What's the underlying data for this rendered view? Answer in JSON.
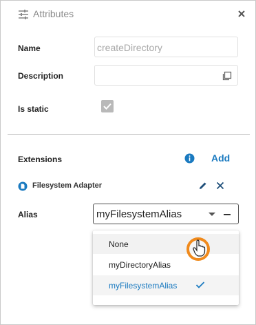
{
  "panel": {
    "title": "Attributes",
    "close_icon": "close-icon",
    "title_icon": "tune-icon"
  },
  "fields": {
    "name_label": "Name",
    "name_value": "createDirectory",
    "description_label": "Description",
    "description_value": "",
    "is_static_label": "Is static",
    "is_static_checked": true
  },
  "extensions": {
    "label": "Extensions",
    "add_label": "Add",
    "adapter_title": "Filesystem Adapter",
    "alias_label": "Alias",
    "alias_selected": "myFilesystemAlias",
    "options": [
      {
        "label": "None",
        "state": "hover"
      },
      {
        "label": "myDirectoryAlias",
        "state": "normal"
      },
      {
        "label": "myFilesystemAlias",
        "state": "selected"
      }
    ]
  },
  "colors": {
    "accent": "#1a7ac0",
    "cursor_ring": "#f08a1c",
    "muted": "#a8a8a8"
  }
}
